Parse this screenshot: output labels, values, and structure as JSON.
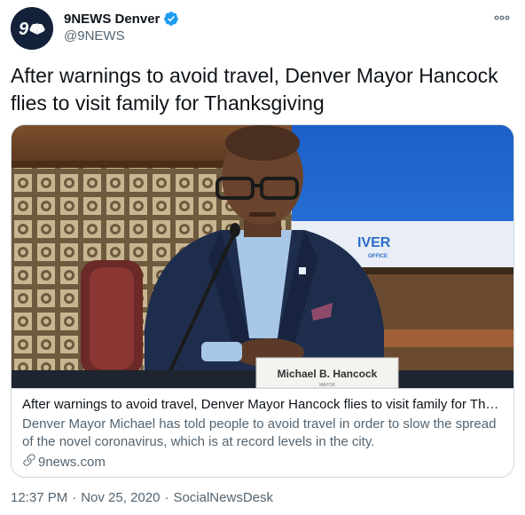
{
  "account": {
    "display_name": "9NEWS Denver",
    "handle": "@9NEWS",
    "avatar_text": "9",
    "verified_icon": "verified-badge-icon",
    "colors": {
      "avatar_bg": "#14213a",
      "verified": "#1d9bf0"
    }
  },
  "tweet": {
    "text": "After warnings to avoid travel, Denver Mayor Hancock flies to visit family for Thanksgiving"
  },
  "card": {
    "image_nameplate": "Michael B. Hancock",
    "image_nameplate_sub": "MAYOR",
    "image_screen_text": "IVER",
    "image_screen_sub": "OFFICE",
    "title": "After warnings to avoid travel, Denver Mayor Hancock flies to visit family for Thanksgiving",
    "description": "Denver Mayor Michael has told people to avoid travel in order to slow the spread of the novel coronavirus, which is at record levels in the city.",
    "domain": "9news.com",
    "domain_icon": "link-icon"
  },
  "meta": {
    "time": "12:37 PM",
    "separator": "·",
    "date": "Nov 25, 2020",
    "source": "SocialNewsDesk"
  },
  "menu": {
    "icon": "more-options-icon"
  }
}
